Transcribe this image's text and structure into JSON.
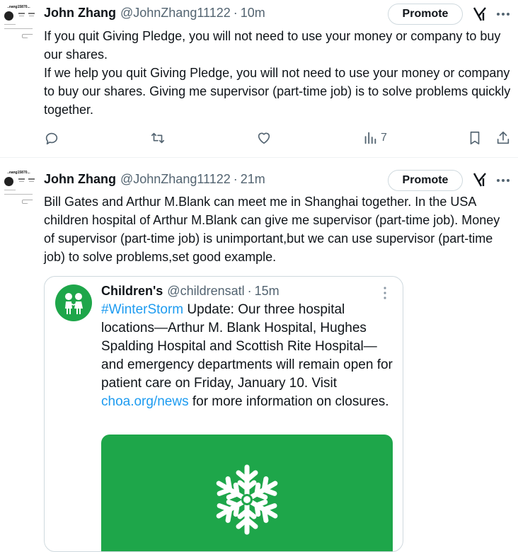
{
  "colors": {
    "accent": "#1d9bf0",
    "brand_green": "#1ea64a",
    "muted": "#536471",
    "text": "#0f1419"
  },
  "tweets": [
    {
      "avatar_text": "...zhang15870...",
      "author": "John Zhang",
      "handle": "@JohnZhang11122",
      "separator": "·",
      "time": "10m",
      "promote": "Promote",
      "lines": [
        "If you quit Giving Pledge, you will not need to use your money or company to buy our shares.",
        "If we help you quit Giving Pledge,  you will not need to use your money or company to buy our shares. Giving me supervisor (part-time job) is to solve problems quickly together."
      ],
      "actions": {
        "reply_icon": "reply-icon",
        "retweet_icon": "retweet-icon",
        "like_icon": "like-icon",
        "views_icon": "views-icon",
        "views": "7",
        "bookmark_icon": "bookmark-icon",
        "share_icon": "share-icon"
      }
    },
    {
      "avatar_text": "...zhang15870...",
      "author": "John Zhang",
      "handle": "@JohnZhang11122",
      "separator": "·",
      "time": "21m",
      "promote": "Promote",
      "text": "Bill Gates and Arthur M.Blank can meet me in Shanghai together. In the USA children hospital of Arthur M.Blank can give me supervisor (part-time job). Money of supervisor (part-time job) is unimportant,but we can use supervisor (part-time job) to solve problems,set good example.",
      "quote": {
        "author": "Children's",
        "handle": "@childrensatl",
        "separator": "·",
        "time": "15m",
        "hashtag": "#WinterStorm",
        "text_1": " Update: Our three hospital locations—Arthur M. Blank Hospital, Hughes Spalding Hospital and Scottish Rite Hospital—and emergency departments will remain open for patient care on Friday, January 10. Visit ",
        "link": "choa.org/news",
        "text_2": " for more information on closures.",
        "media_icon": "snowflake-icon"
      }
    }
  ]
}
